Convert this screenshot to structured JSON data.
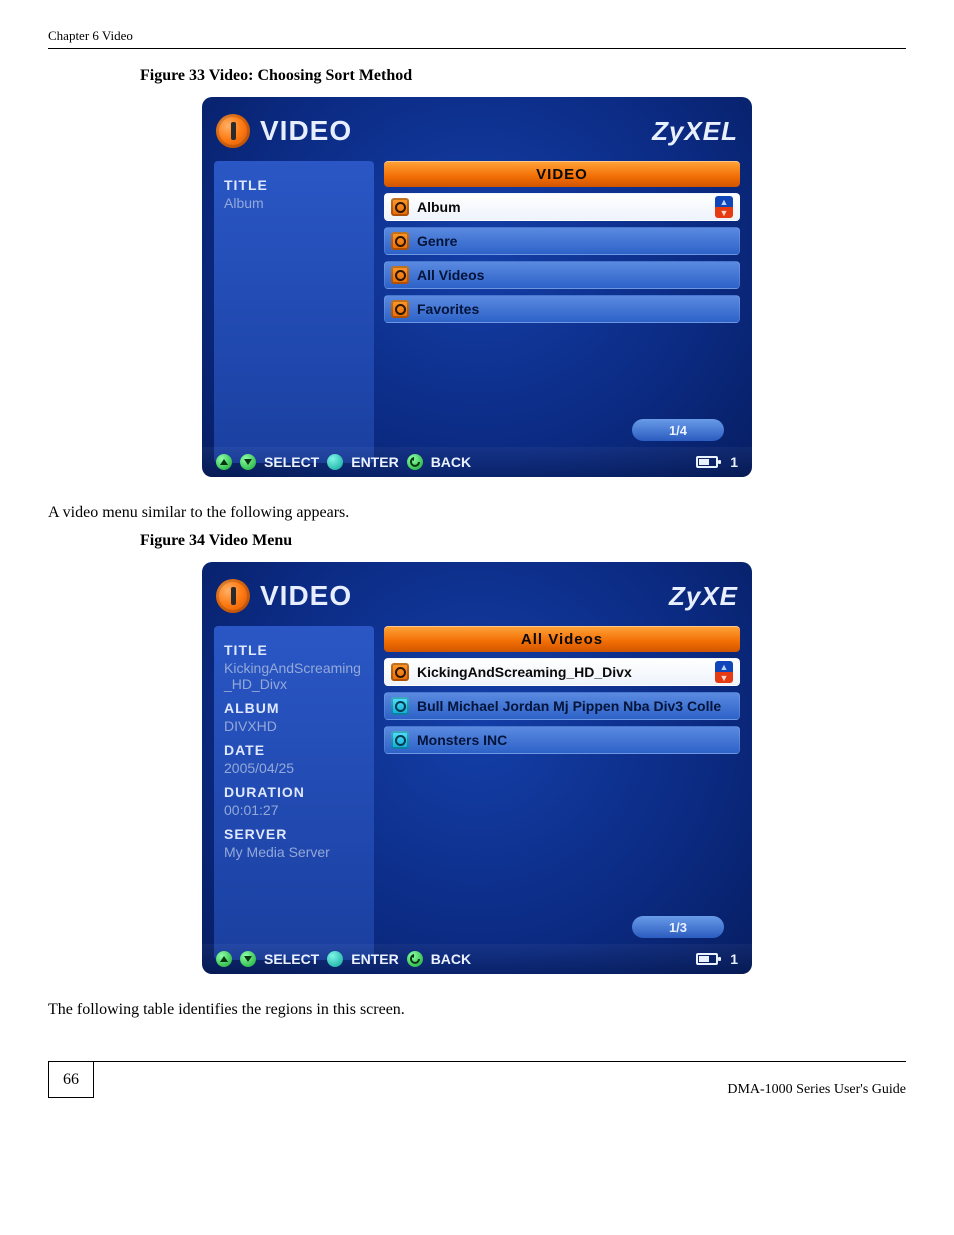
{
  "running_head": "Chapter 6 Video",
  "figure33": {
    "caption": "Figure 33   Video: Choosing Sort Method",
    "logo_text": "VIDEO",
    "brand": "ZyXEL",
    "side_label": "TITLE",
    "side_value": "Album",
    "header": "VIDEO",
    "items": [
      "Album",
      "Genre",
      "All Videos",
      "Favorites"
    ],
    "pager": "1/4",
    "foot_select": "SELECT",
    "foot_enter": "ENTER",
    "foot_back": "BACK",
    "batt_count": "1"
  },
  "midline": "A video menu similar to the following appears.",
  "figure34": {
    "caption": "Figure 34   Video Menu",
    "logo_text": "VIDEO",
    "brand": "ZyXE",
    "side": {
      "title_lbl": "TITLE",
      "title_val": "KickingAndScreaming_HD_Divx",
      "album_lbl": "ALBUM",
      "album_val": "DIVXHD",
      "date_lbl": "DATE",
      "date_val": "2005/04/25",
      "duration_lbl": "DURATION",
      "duration_val": "00:01:27",
      "server_lbl": "SERVER",
      "server_val": "My Media Server"
    },
    "header": "All Videos",
    "items": [
      "KickingAndScreaming_HD_Divx",
      "Bull Michael Jordan Mj Pippen Nba Div3 Colle",
      "Monsters INC"
    ],
    "pager": "1/3",
    "foot_select": "SELECT",
    "foot_enter": "ENTER",
    "foot_back": "BACK",
    "batt_count": "1"
  },
  "after_text": "The following table identifies the regions in this screen.",
  "page_footer": {
    "number": "66",
    "guide": "DMA-1000 Series User's Guide"
  }
}
